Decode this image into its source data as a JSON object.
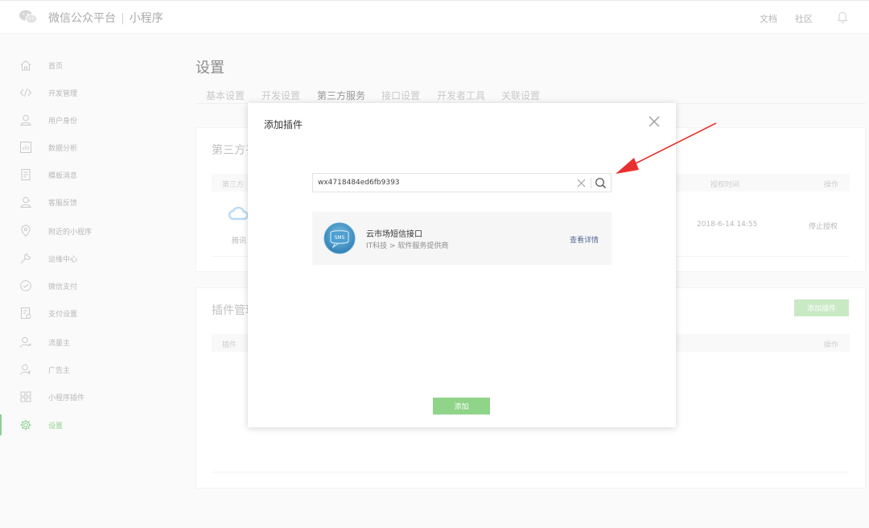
{
  "header": {
    "brand": "微信公众平台",
    "separator": "|",
    "product": "小程序",
    "links": {
      "docs": "文档",
      "community": "社区"
    }
  },
  "sidebar": {
    "items": [
      {
        "label": "首页",
        "icon": "home-icon"
      },
      {
        "label": "开发管理",
        "icon": "code-icon"
      },
      {
        "label": "用户身份",
        "icon": "user-icon"
      },
      {
        "label": "数据分析",
        "icon": "chart-icon"
      },
      {
        "label": "模板消息",
        "icon": "template-icon"
      },
      {
        "label": "客服反馈",
        "icon": "service-icon"
      },
      {
        "label": "附近的小程序",
        "icon": "location-icon"
      },
      {
        "label": "运维中心",
        "icon": "wrench-icon"
      },
      {
        "label": "微信支付",
        "icon": "pay-icon"
      },
      {
        "label": "支付设置",
        "icon": "pay-settings-icon"
      },
      {
        "label": "流量主",
        "icon": "traffic-icon"
      },
      {
        "label": "广告主",
        "icon": "advertiser-icon"
      },
      {
        "label": "小程序插件",
        "icon": "plugin-icon"
      },
      {
        "label": "设置",
        "icon": "gear-icon",
        "active": true
      }
    ],
    "accent": "#44b549"
  },
  "main": {
    "title": "设置",
    "tabs": [
      {
        "label": "基本设置"
      },
      {
        "label": "开发设置"
      },
      {
        "label": "第三方服务",
        "active": true
      },
      {
        "label": "接口设置"
      },
      {
        "label": "开发者工具"
      },
      {
        "label": "关联设置"
      }
    ],
    "third_party": {
      "title": "第三方平",
      "col_first": "第三方",
      "col_time": "授权时间",
      "col_action": "操作",
      "row": {
        "name": "腾讯",
        "time": "2018-6-14 14:55",
        "action": "停止授权"
      }
    },
    "plugins": {
      "title": "插件管理",
      "add_button": "添加插件",
      "col_first": "插件",
      "col_action": "操作"
    }
  },
  "modal": {
    "title": "添加插件",
    "search": {
      "value": "wx4718484ed6fb9393",
      "placeholder": ""
    },
    "result": {
      "name": "云市场短信接口",
      "category": "IT科技 > 软件服务提供商",
      "detail_link": "查看详情",
      "logo_text": "SMS"
    },
    "add_button": "添加"
  },
  "colors": {
    "primary": "#44b549",
    "link": "#576b95",
    "annotation": "#e8312f"
  }
}
